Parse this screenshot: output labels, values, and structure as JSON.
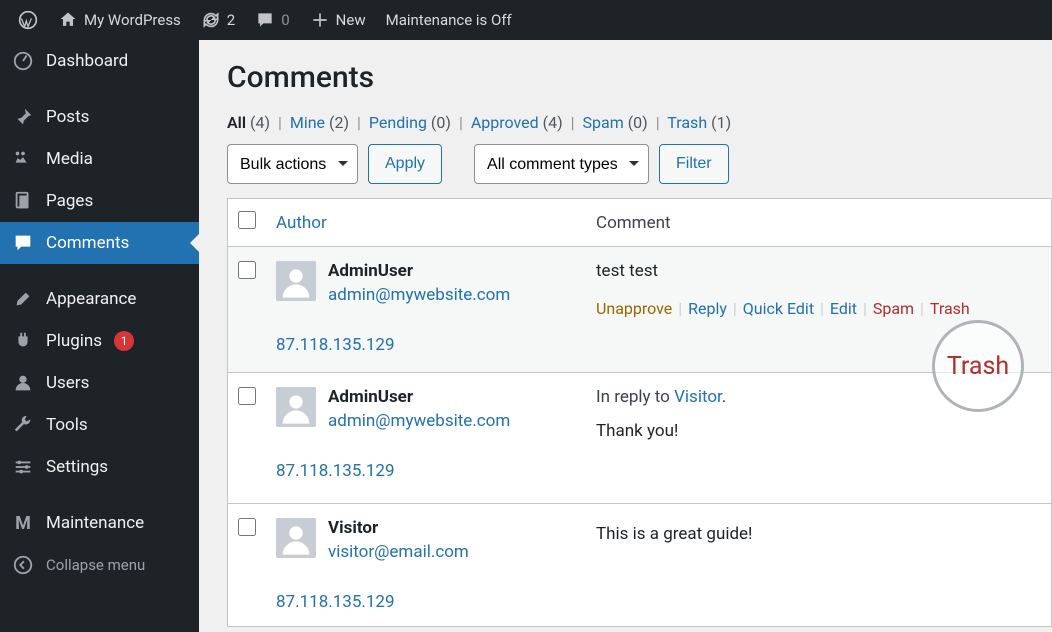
{
  "adminbar": {
    "site_title": "My WordPress",
    "updates_count": "2",
    "comments_count": "0",
    "new_label": "New",
    "maintenance_label": "Maintenance is Off"
  },
  "sidebar": {
    "items": [
      {
        "label": "Dashboard"
      },
      {
        "label": "Posts"
      },
      {
        "label": "Media"
      },
      {
        "label": "Pages"
      },
      {
        "label": "Comments"
      },
      {
        "label": "Appearance"
      },
      {
        "label": "Plugins",
        "badge": "1"
      },
      {
        "label": "Users"
      },
      {
        "label": "Tools"
      },
      {
        "label": "Settings"
      },
      {
        "label": "Maintenance"
      },
      {
        "label": "Collapse menu"
      }
    ]
  },
  "page": {
    "title": "Comments",
    "filters": {
      "all_label": "All",
      "all_count": "(4)",
      "mine_label": "Mine",
      "mine_count": "(2)",
      "pending_label": "Pending",
      "pending_count": "(0)",
      "approved_label": "Approved",
      "approved_count": "(4)",
      "spam_label": "Spam",
      "spam_count": "(0)",
      "trash_label": "Trash",
      "trash_count": "(1)"
    },
    "bulk_select": "Bulk actions",
    "apply_btn": "Apply",
    "type_select": "All comment types",
    "filter_btn": "Filter",
    "columns": {
      "author": "Author",
      "comment": "Comment"
    },
    "rows": [
      {
        "author_name": "AdminUser",
        "author_email": "admin@mywebsite.com",
        "author_ip": "87.118.135.129",
        "content": "test test",
        "reply_to_prefix": "",
        "reply_to_name": "",
        "show_actions": true
      },
      {
        "author_name": "AdminUser",
        "author_email": "admin@mywebsite.com",
        "author_ip": "87.118.135.129",
        "reply_to_prefix": "In reply to ",
        "reply_to_name": "Visitor",
        "content": "Thank you!",
        "show_actions": false
      },
      {
        "author_name": "Visitor",
        "author_email": "visitor@email.com",
        "author_ip": "87.118.135.129",
        "reply_to_prefix": "",
        "reply_to_name": "",
        "content": "This is a great guide!",
        "show_actions": false
      }
    ],
    "row_actions": {
      "unapprove": "Unapprove",
      "reply": "Reply",
      "quick_edit": "Quick Edit",
      "edit": "Edit",
      "spam": "Spam",
      "trash": "Trash"
    },
    "trash_highlight": "Trash"
  }
}
